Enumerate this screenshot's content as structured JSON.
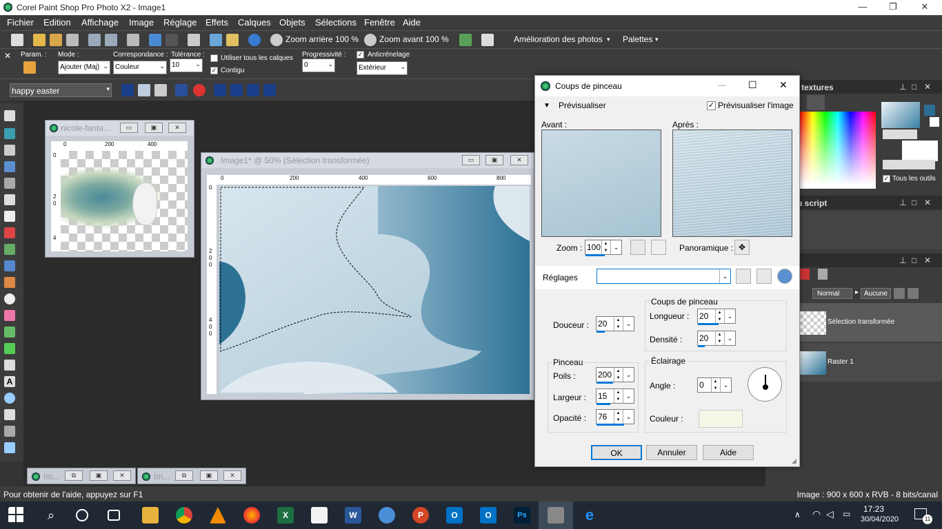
{
  "window": {
    "title": "Corel Paint Shop Pro Photo X2 - Image1"
  },
  "menu": [
    "Fichier",
    "Edition",
    "Affichage",
    "Image",
    "Réglage",
    "Effets",
    "Calques",
    "Objets",
    "Sélections",
    "Fenêtre",
    "Aide"
  ],
  "toolbar": {
    "zoom_out": "Zoom arrière 100 %",
    "zoom_in": "Zoom avant 100 %",
    "enhance": "Amélioration des photos",
    "palettes": "Palettes"
  },
  "options": {
    "param_label": "Param. :",
    "mode_label": "Mode :",
    "mode_value": "Ajouter (Maj)",
    "match_label": "Correspondance :",
    "match_value": "Couleur",
    "tol_label": "Tolérance :",
    "tol_value": "10",
    "all_layers": "Utiliser tous les calques",
    "contig": "Contigu",
    "prog_label": "Progressivité :",
    "prog_value": "0",
    "aa_label": "Anticrénelage",
    "aa_value": "Extérieur"
  },
  "script": {
    "name": "happy easter"
  },
  "docs": {
    "doc1": {
      "title": "nicole-fanta...",
      "ruler_top": [
        "0",
        "200",
        "400"
      ],
      "ruler_left": [
        "0",
        "2",
        "0",
        "4"
      ]
    },
    "doc2": {
      "title": "Image1* @  50% (Sélection transformée)",
      "ruler_top": [
        "0",
        "200",
        "400",
        "600",
        "800"
      ],
      "ruler_left": [
        "0",
        "2",
        "0",
        "0",
        "4",
        "0",
        "0"
      ]
    },
    "min1": {
      "title": "Im..."
    },
    "min2": {
      "title": "Im..."
    }
  },
  "panels": {
    "textures": "textures",
    "all_tools": "Tous les outils",
    "script": "u script",
    "blend": "Normal",
    "mask": "Aucune",
    "layers": [
      {
        "name": "Sélection transformée"
      },
      {
        "name": "Raster 1"
      }
    ]
  },
  "dialog": {
    "title": "Coups de pinceau",
    "preview_toggle": "Prévisualiser",
    "preview_image": "Prévisualiser l'image",
    "before": "Avant :",
    "after": "Après :",
    "zoom_label": "Zoom :",
    "zoom": "100",
    "pan": "Panoramique :",
    "settings": "Réglages",
    "settings_value": "",
    "grp_strokes": "Coups de pinceau",
    "length_label": "Longueur :",
    "length": "20",
    "density_label": "Densité :",
    "density": "20",
    "softness_label": "Douceur :",
    "softness": "20",
    "grp_brush": "Pinceau",
    "bristles_label": "Poils :",
    "bristles": "200",
    "width_label": "Largeur :",
    "width": "15",
    "opacity_label": "Opacité :",
    "opacity": "76",
    "grp_light": "Éclairage",
    "angle_label": "Angle :",
    "angle": "0",
    "color_label": "Couleur :",
    "ok": "OK",
    "cancel": "Annuler",
    "help": "Aide"
  },
  "status": {
    "left": "Pour obtenir de l'aide, appuyez sur F1",
    "right": "Image :  900 x 600 x RVB - 8 bits/canal"
  },
  "taskbar": {
    "time": "17:23",
    "date": "30/04/2020",
    "notif": "11"
  },
  "colors": {
    "accent": "#0078d7",
    "light_color": "#f5f6e6",
    "image_teal": "#2d7295"
  }
}
